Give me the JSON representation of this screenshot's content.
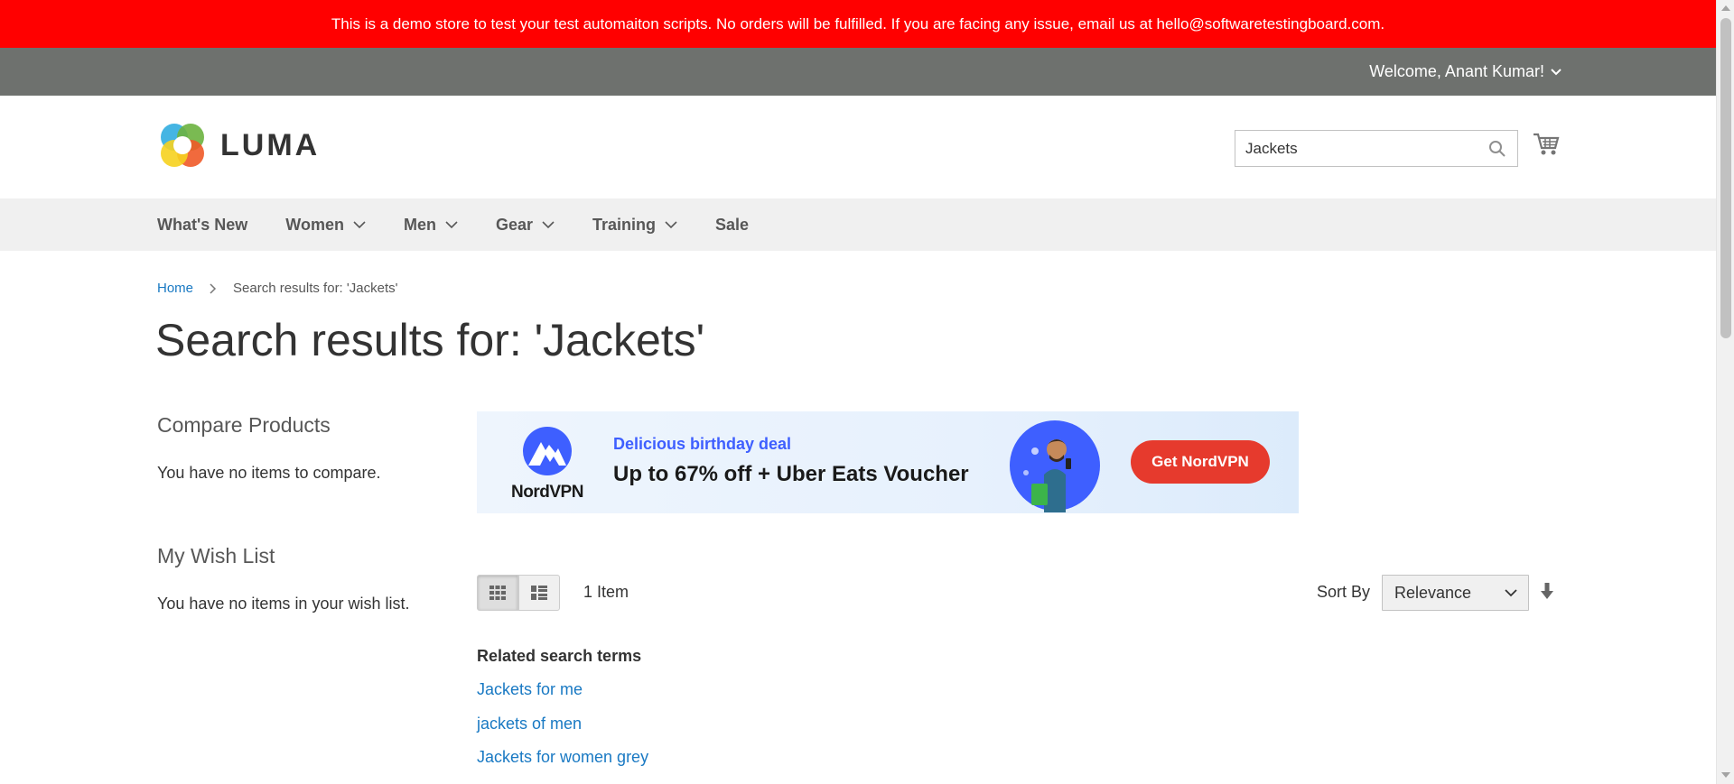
{
  "demo_notice": "This is a demo store to test your test automaiton scripts. No orders will be fulfilled. If you are facing any issue, email us at hello@softwaretestingboard.com.",
  "account": {
    "welcome": "Welcome, Anant Kumar!"
  },
  "logo": {
    "text": "LUMA"
  },
  "search": {
    "value": "Jackets"
  },
  "nav": {
    "items": [
      {
        "label": "What's New"
      },
      {
        "label": "Women"
      },
      {
        "label": "Men"
      },
      {
        "label": "Gear"
      },
      {
        "label": "Training"
      },
      {
        "label": "Sale"
      }
    ]
  },
  "breadcrumb": {
    "home": "Home",
    "current": "Search results for: 'Jackets'"
  },
  "page_title": "Search results for: 'Jackets'",
  "sidebar": {
    "compare_title": "Compare Products",
    "compare_text": "You have no items to compare.",
    "wishlist_title": "My Wish List",
    "wishlist_text": "You have no items in your wish list."
  },
  "ad": {
    "brand": "NordVPN",
    "subheading": "Delicious birthday deal",
    "headline": "Up to 67% off + Uber Eats Voucher",
    "cta": "Get NordVPN"
  },
  "toolbar": {
    "item_count": "1 Item",
    "sort_label": "Sort By",
    "sort_value": "Relevance"
  },
  "related": {
    "title": "Related search terms",
    "terms": [
      "Jackets for me",
      "jackets of men",
      "Jackets for women grey"
    ]
  },
  "colors": {
    "demo_banner": "#ff0000",
    "account_bar": "#6e716e",
    "link": "#1979c3",
    "nav_bg": "#f0f0f0",
    "ad_cta": "#e63a2d"
  }
}
